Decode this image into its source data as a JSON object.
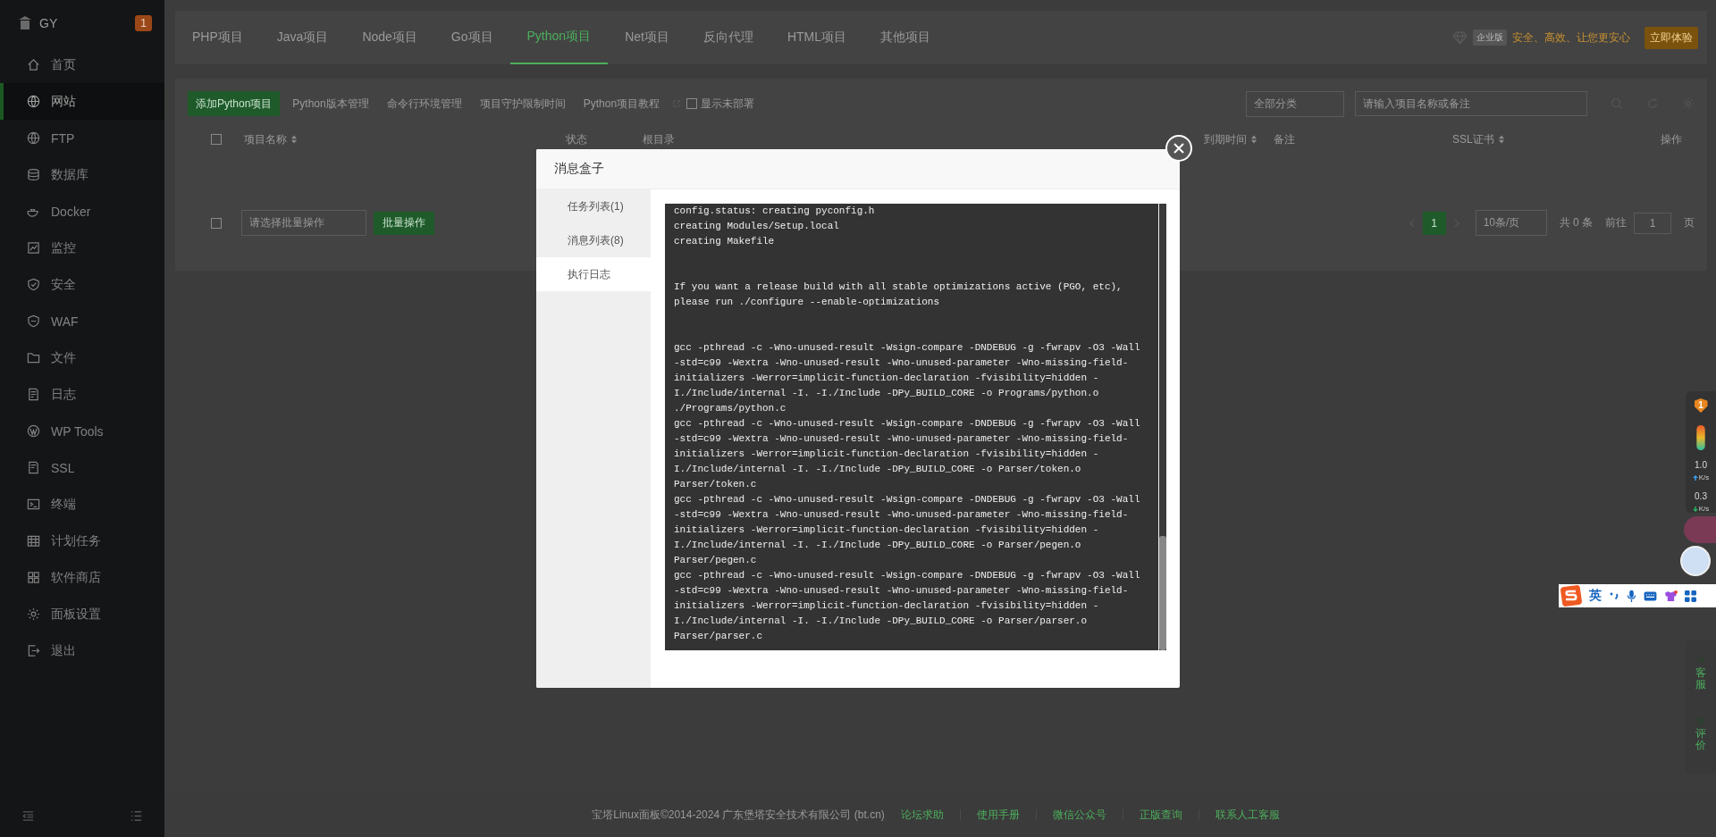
{
  "sidebar": {
    "logo": "GY",
    "badge": "1",
    "items": [
      {
        "label": "首页",
        "selected": false
      },
      {
        "label": "网站",
        "selected": true
      },
      {
        "label": "FTP",
        "selected": false
      },
      {
        "label": "数据库",
        "selected": false
      },
      {
        "label": "Docker",
        "selected": false
      },
      {
        "label": "监控",
        "selected": false
      },
      {
        "label": "安全",
        "selected": false
      },
      {
        "label": "WAF",
        "selected": false
      },
      {
        "label": "文件",
        "selected": false
      },
      {
        "label": "日志",
        "selected": false
      },
      {
        "label": "WP Tools",
        "selected": false
      },
      {
        "label": "SSL",
        "selected": false
      },
      {
        "label": "终端",
        "selected": false
      },
      {
        "label": "计划任务",
        "selected": false
      },
      {
        "label": "软件商店",
        "selected": false
      },
      {
        "label": "面板设置",
        "selected": false
      },
      {
        "label": "退出",
        "selected": false
      }
    ]
  },
  "top_tabs": [
    {
      "label": "PHP项目",
      "selected": false
    },
    {
      "label": "Java项目",
      "selected": false
    },
    {
      "label": "Node项目",
      "selected": false
    },
    {
      "label": "Go项目",
      "selected": false
    },
    {
      "label": "Python项目",
      "selected": true
    },
    {
      "label": "Net项目",
      "selected": false
    },
    {
      "label": "反向代理",
      "selected": false
    },
    {
      "label": "HTML项目",
      "selected": false
    },
    {
      "label": "其他项目",
      "selected": false
    }
  ],
  "promo": {
    "edition": "企业版",
    "slogan": "安全、高效、让您更安心",
    "button": "立即体验"
  },
  "toolbar": {
    "add_button": "添加Python项目",
    "links": [
      "Python版本管理",
      "命令行环境管理",
      "项目守护限制时间"
    ],
    "tutorial_link": "Python项目教程",
    "show_undeployed": {
      "label": "显示未部署",
      "checked": false
    },
    "category_select": "全部分类",
    "search": {
      "placeholder": "请输入项目名称或备注"
    }
  },
  "table": {
    "select_all": {
      "checked": false
    },
    "columns": [
      {
        "label": "项目名称",
        "sortable": true
      },
      {
        "label": "状态",
        "sortable": false
      },
      {
        "label": "根目录",
        "sortable": false
      },
      {
        "label": "到期时间",
        "sortable": true
      },
      {
        "label": "备注",
        "sortable": false
      },
      {
        "label": "SSL证书",
        "sortable": true
      },
      {
        "label": "操作",
        "sortable": false
      }
    ]
  },
  "pagination": {
    "select_all": {
      "checked": false
    },
    "batch_select": "请选择批量操作",
    "batch_button": "批量操作",
    "pages": [
      {
        "label": "1",
        "selected": true
      }
    ],
    "page_size": "10条/页",
    "total": "共 0 条",
    "goto_label": "前往",
    "goto_value": "1",
    "page_unit": "页"
  },
  "modal": {
    "title": "消息盒子",
    "tabs": [
      {
        "label": "任务列表(1)",
        "selected": false
      },
      {
        "label": "消息列表(8)",
        "selected": false
      },
      {
        "label": "执行日志",
        "selected": true
      }
    ],
    "log_blocks": [
      [
        "config.status: creating pyconfig.h",
        "creating Modules/Setup.local",
        "creating Makefile"
      ],
      [
        "If you want a release build with all stable optimizations active (PGO, etc),",
        "please run ./configure --enable-optimizations"
      ],
      [
        "gcc -pthread -c -Wno-unused-result -Wsign-compare -DNDEBUG -g -fwrapv -O3 -Wall",
        "-std=c99 -Wextra -Wno-unused-result -Wno-unused-parameter -Wno-missing-field-",
        "initializers -Werror=implicit-function-declaration -fvisibility=hidden -",
        "I./Include/internal -I. -I./Include -DPy_BUILD_CORE -o Programs/python.o",
        "./Programs/python.c",
        "gcc -pthread -c -Wno-unused-result -Wsign-compare -DNDEBUG -g -fwrapv -O3 -Wall",
        "-std=c99 -Wextra -Wno-unused-result -Wno-unused-parameter -Wno-missing-field-",
        "initializers -Werror=implicit-function-declaration -fvisibility=hidden -",
        "I./Include/internal -I. -I./Include -DPy_BUILD_CORE -o Parser/token.o",
        "Parser/token.c",
        "gcc -pthread -c -Wno-unused-result -Wsign-compare -DNDEBUG -g -fwrapv -O3 -Wall",
        "-std=c99 -Wextra -Wno-unused-result -Wno-unused-parameter -Wno-missing-field-",
        "initializers -Werror=implicit-function-declaration -fvisibility=hidden -",
        "I./Include/internal -I. -I./Include -DPy_BUILD_CORE -o Parser/pegen.o",
        "Parser/pegen.c",
        "gcc -pthread -c -Wno-unused-result -Wsign-compare -DNDEBUG -g -fwrapv -O3 -Wall",
        "-std=c99 -Wextra -Wno-unused-result -Wno-unused-parameter -Wno-missing-field-",
        "initializers -Werror=implicit-function-declaration -fvisibility=hidden -",
        "I./Include/internal -I. -I./Include -DPy_BUILD_CORE -o Parser/parser.o",
        "Parser/parser.c"
      ]
    ]
  },
  "float_panel": {
    "shield_badge": "1",
    "speed_up": {
      "value": "1.0",
      "unit": "K/s"
    },
    "speed_down": {
      "value": "0.3",
      "unit": "K/s"
    },
    "service": "客服",
    "review": "评价"
  },
  "ime": {
    "mode": "英"
  },
  "footer": {
    "copyright": "宝塔Linux面板©2014-2024 广东堡塔安全技术有限公司 (bt.cn)",
    "links": [
      "论坛求助",
      "使用手册",
      "微信公众号",
      "正版查询",
      "联系人工客服"
    ]
  }
}
